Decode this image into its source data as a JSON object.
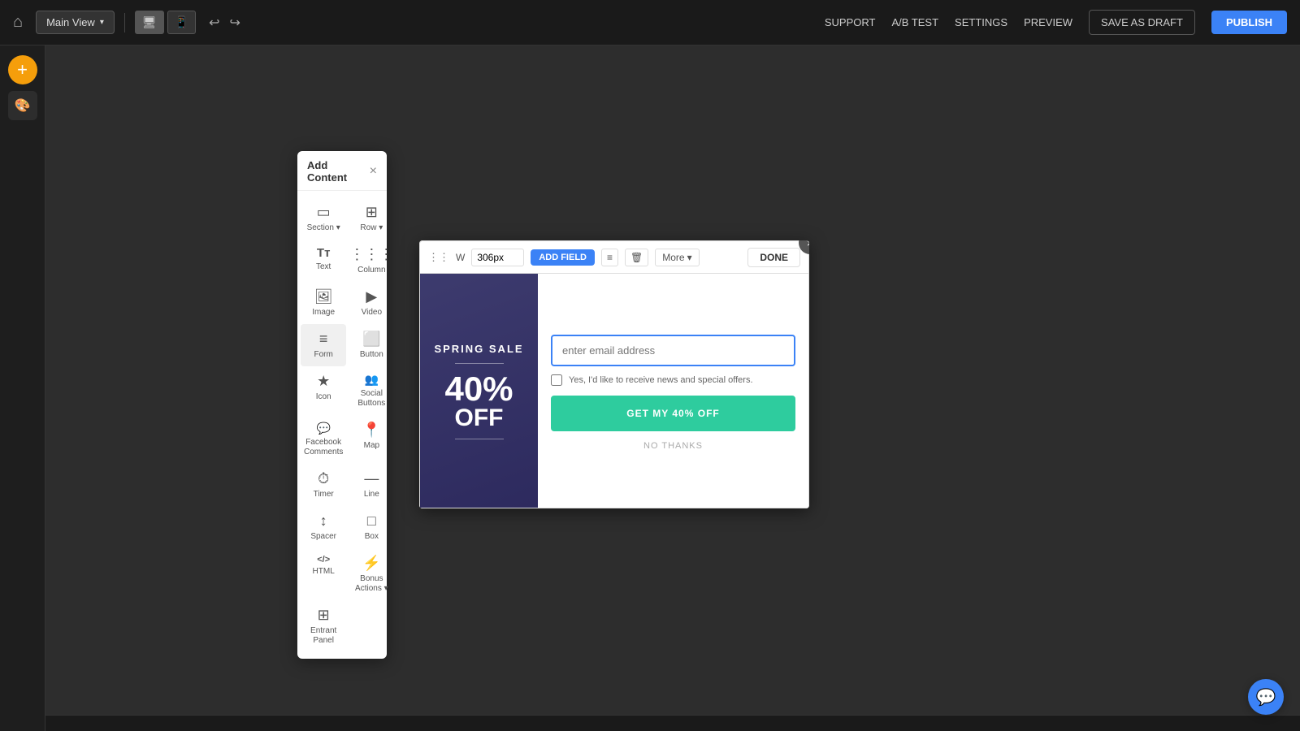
{
  "topbar": {
    "home_icon": "⌂",
    "main_view_label": "Main View",
    "device_icon_desktop": "▭",
    "device_icon_mobile": "▯",
    "undo_icon": "↩",
    "redo_icon": "↪",
    "support_label": "SUPPORT",
    "ab_test_label": "A/B TEST",
    "settings_label": "SETTINGS",
    "preview_label": "PREVIEW",
    "save_draft_label": "SAVE AS DRAFT",
    "publish_label": "PUBLISH"
  },
  "left_sidebar": {
    "add_icon": "+",
    "paint_icon": "🎨"
  },
  "add_content_panel": {
    "title": "Add Content",
    "close_icon": "×",
    "items": [
      {
        "label": "Section",
        "icon": "▭",
        "has_arrow": true
      },
      {
        "label": "Row",
        "icon": "⊞",
        "has_arrow": true
      },
      {
        "label": "Text",
        "icon": "Tт"
      },
      {
        "label": "Column",
        "icon": "|||"
      },
      {
        "label": "Image",
        "icon": "🖼"
      },
      {
        "label": "Video",
        "icon": "▶"
      },
      {
        "label": "Form",
        "icon": "≡"
      },
      {
        "label": "Button",
        "icon": "⬜"
      },
      {
        "label": "Icon",
        "icon": "★"
      },
      {
        "label": "Social Buttons",
        "icon": "👥"
      },
      {
        "label": "Facebook Comments",
        "icon": "💬"
      },
      {
        "label": "Map",
        "icon": "📍"
      },
      {
        "label": "Timer",
        "icon": "⏱"
      },
      {
        "label": "Line",
        "icon": "—"
      },
      {
        "label": "Spacer",
        "icon": "↕"
      },
      {
        "label": "Box",
        "icon": "□"
      },
      {
        "label": "HTML",
        "icon": "</>"
      },
      {
        "label": "Bonus Actions",
        "icon": "⚡",
        "has_arrow": true
      },
      {
        "label": "Entrant Panel",
        "icon": "⊞"
      }
    ]
  },
  "form_toolbar": {
    "width_label": "W",
    "width_value": "306px",
    "add_field_label": "ADD FIELD",
    "list_icon": "≡",
    "delete_icon": "🗑",
    "more_label": "More",
    "done_label": "DONE"
  },
  "spring_sale": {
    "title": "SPRING SALE",
    "percent": "40%",
    "off": "OFF"
  },
  "form_content": {
    "email_placeholder": "enter email address",
    "checkbox_label": "Yes, I'd like to receive news and special offers.",
    "cta_button": "GET MY 40% OFF",
    "no_thanks": "NO THANKS"
  },
  "chat_bubble": {
    "icon": "💬"
  },
  "colors": {
    "blue": "#3b82f6",
    "teal": "#2ecc9e",
    "dark_bg": "#2d2d2d",
    "panel_purple": "#3d3b6e"
  }
}
